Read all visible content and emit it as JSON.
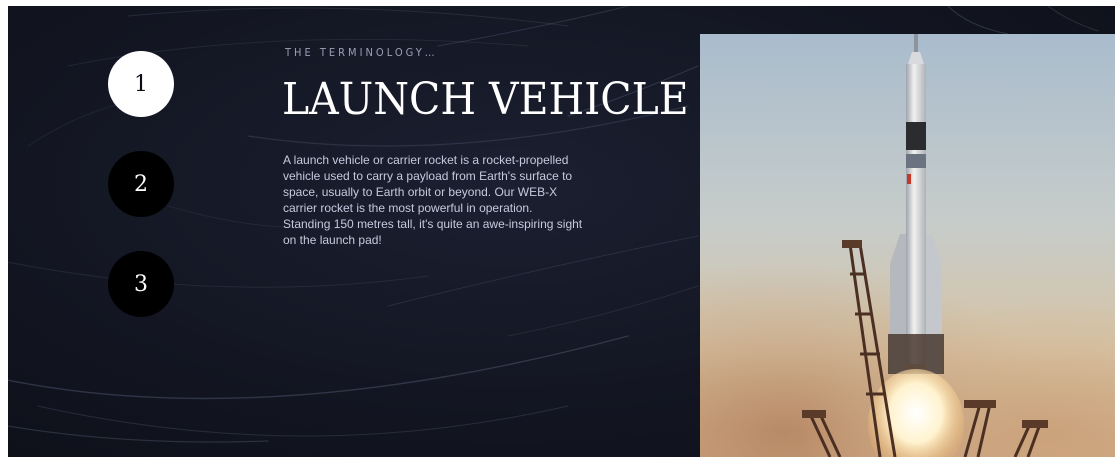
{
  "nav": {
    "items": [
      {
        "label": "1",
        "active": true
      },
      {
        "label": "2",
        "active": false
      },
      {
        "label": "3",
        "active": false
      }
    ]
  },
  "content": {
    "eyebrow": "THE TERMINOLOGY…",
    "title": "LAUNCH VEHICLE",
    "description": "A launch vehicle or carrier rocket is a rocket-propelled vehicle used to carry a payload from Earth's surface to space, usually to Earth orbit or beyond. Our WEB-X carrier rocket is the most powerful in operation. Standing 150 metres tall, it's quite an awe-inspiring sight on the launch pad!"
  },
  "colors": {
    "background": "#131622",
    "active_button": "#ffffff",
    "inactive_button": "#000000",
    "eyebrow_text": "#9aa0b6",
    "body_text": "#c6cadd"
  }
}
